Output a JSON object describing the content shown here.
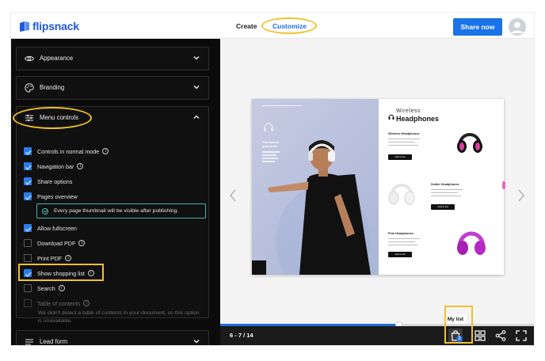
{
  "topbar": {
    "brand": "flipsnack",
    "nav": [
      {
        "label": "Create"
      },
      {
        "label": "Customize"
      }
    ],
    "share_label": "Share now"
  },
  "sidebar": {
    "appearance_label": "Appearance",
    "branding_label": "Branding",
    "menu_controls_label": "Menu controls",
    "lead_form_label": "Lead form",
    "options": [
      {
        "label": "Controls in normal mode",
        "checked": true,
        "info": true
      },
      {
        "label": "Navigation bar",
        "checked": true,
        "info": true
      },
      {
        "label": "Share options",
        "checked": true,
        "info": false
      },
      {
        "label": "Pages overview",
        "checked": true,
        "info": false
      },
      {
        "label": "Allow fullscreen",
        "checked": true,
        "info": false
      },
      {
        "label": "Download PDF",
        "checked": false,
        "info": true
      },
      {
        "label": "Print PDF",
        "checked": false,
        "info": true
      },
      {
        "label": "Show shopping list",
        "checked": true,
        "info": true
      },
      {
        "label": "Search",
        "checked": false,
        "info": true
      },
      {
        "label": "Table of contents",
        "checked": false,
        "info": true,
        "disabled": true
      }
    ],
    "pages_overview_notice": "Every page thumbnail will be visible after publishing.",
    "toc_note": "We didn't detect a table of contents in your document, so this option is unavailable.",
    "info_glyph": "i"
  },
  "flipbook": {
    "left_caption": "The launch\nguarantee",
    "right_title_line1": "Wireless",
    "right_title_line2": "Headphones",
    "products": [
      {
        "name": "Wireless Headphones",
        "button": "Add to list"
      },
      {
        "name": "Solder Headphones",
        "button": "Add to list"
      },
      {
        "name": "Pink Headphones",
        "button": "Add to list"
      }
    ]
  },
  "controls": {
    "page_indicator": "6 - 7 / 14",
    "progress": 0.57,
    "tooltip": "My list",
    "cart_count": "2"
  },
  "colors": {
    "accent": "#1a73e8",
    "highlight": "#f2c12e",
    "sidebar_bg": "#0b0b0b",
    "notice_border": "#3fb6b0"
  },
  "icons": [
    "eye-icon",
    "palette-icon",
    "sliders-icon",
    "list-icon",
    "chevron-down-icon",
    "chevron-up-icon",
    "info-icon",
    "check-circle-icon",
    "shopping-bag-icon",
    "grid-icon",
    "share-icon",
    "fullscreen-icon",
    "chevron-left-icon",
    "chevron-right-icon",
    "user-icon"
  ]
}
